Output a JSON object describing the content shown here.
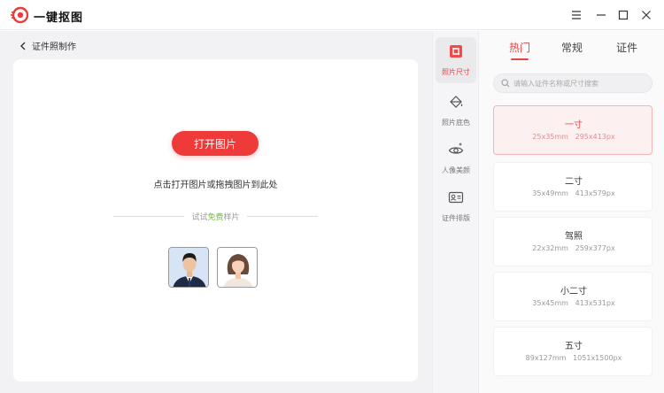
{
  "app": {
    "title": "一键抠图"
  },
  "window_controls": {
    "menu": "menu-icon",
    "minimize": "minimize-icon",
    "maximize": "maximize-icon",
    "close": "close-icon"
  },
  "breadcrumb": {
    "back_label": "证件照制作"
  },
  "workspace": {
    "open_button": "打开图片",
    "hint": "点击打开图片或拖拽图片到此处",
    "sample_prefix": "试试",
    "sample_free": "免费",
    "sample_suffix": "样片"
  },
  "tools": [
    {
      "label": "照片尺寸",
      "icon": "crop-icon",
      "active": true
    },
    {
      "label": "照片底色",
      "icon": "paint-bucket-icon",
      "active": false
    },
    {
      "label": "人像美颜",
      "icon": "eye-sparkle-icon",
      "active": false
    },
    {
      "label": "证件排版",
      "icon": "id-card-icon",
      "active": false
    }
  ],
  "tabs": [
    {
      "label": "热门",
      "active": true
    },
    {
      "label": "常规",
      "active": false
    },
    {
      "label": "证件",
      "active": false
    }
  ],
  "search": {
    "placeholder": "请输入证件名称或尺寸搜索"
  },
  "sizes": [
    {
      "name": "一寸",
      "mm": "25x35mm",
      "px": "295x413px",
      "selected": true
    },
    {
      "name": "二寸",
      "mm": "35x49mm",
      "px": "413x579px",
      "selected": false
    },
    {
      "name": "驾照",
      "mm": "22x32mm",
      "px": "259x377px",
      "selected": false
    },
    {
      "name": "小二寸",
      "mm": "35x45mm",
      "px": "413x531px",
      "selected": false
    },
    {
      "name": "五寸",
      "mm": "89x127mm",
      "px": "1051x1500px",
      "selected": false
    }
  ],
  "colors": {
    "accent": "#e84545",
    "button": "#ef3a3a",
    "free_text": "#6fbf3c"
  }
}
